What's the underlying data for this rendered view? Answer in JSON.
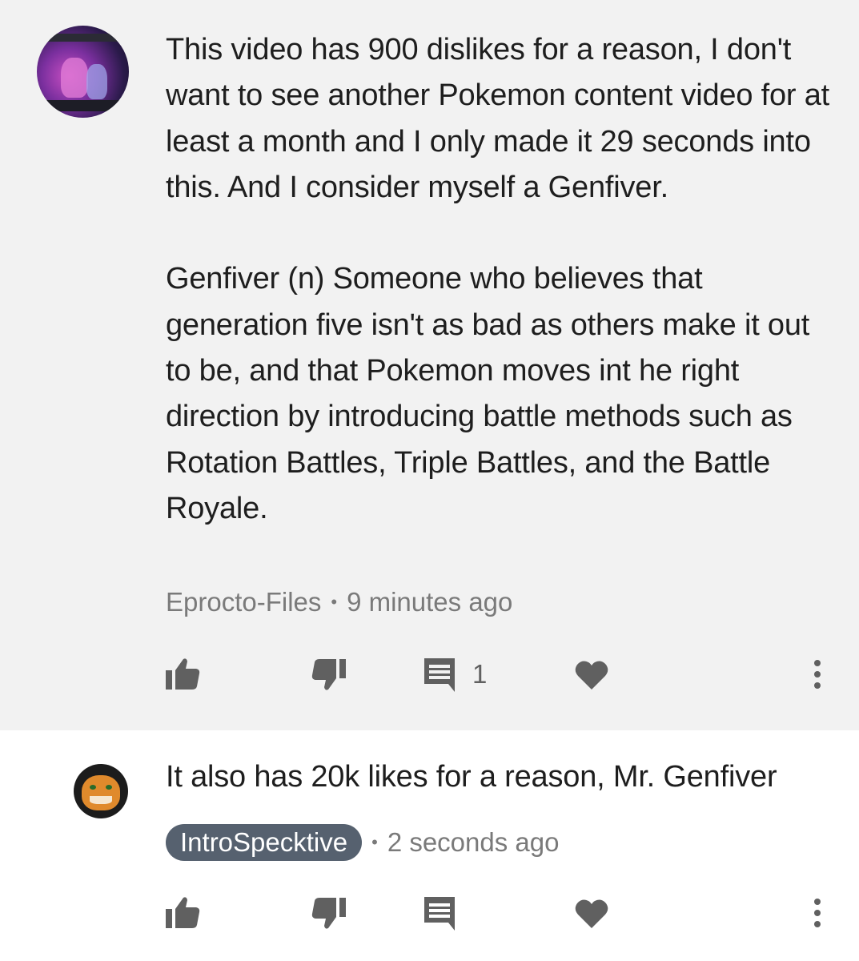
{
  "top_comment": {
    "paragraphs": [
      "This video has 900 dislikes for a reason, I don't want to see another Pokemon content video for at least a month and I only made it 29  seconds into this. And I consider myself a Genfiver.",
      "Genfiver (n) Someone who believes that generation five isn't as bad as others make it out to be, and that Pokemon moves int he right direction by introducing battle methods such as Rotation Battles, Triple Battles, and the Battle Royale."
    ],
    "author": "Eprocto-Files",
    "separator": "•",
    "time": "9 minutes ago",
    "reply_count": "1",
    "icons": [
      "thumbs-up-icon",
      "thumbs-down-icon",
      "reply-icon",
      "heart-icon",
      "more-vert-icon"
    ]
  },
  "reply_comment": {
    "text": "It also has 20k likes for a reason, Mr. Genfiver",
    "author": "IntroSpecktive",
    "separator": "•",
    "time": "2 seconds ago",
    "icons": [
      "thumbs-up-icon",
      "thumbs-down-icon",
      "reply-icon",
      "heart-icon",
      "more-vert-icon"
    ]
  },
  "colors": {
    "top_background": "#f2f2f2",
    "reply_background": "#ffffff",
    "icon": "#606060",
    "meta_text": "#7a7a7a",
    "author_chip": "#56616f"
  }
}
